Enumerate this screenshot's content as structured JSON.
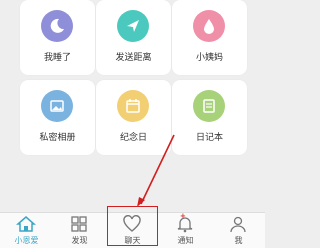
{
  "grid": {
    "row1": [
      {
        "label": "我睡了",
        "icon": "moon-icon",
        "color": "#8f8fd9"
      },
      {
        "label": "发送距离",
        "icon": "send-location-icon",
        "color": "#4cc9bf"
      },
      {
        "label": "小姨妈",
        "icon": "drop-icon",
        "color": "#f08fa8"
      }
    ],
    "row2": [
      {
        "label": "私密相册",
        "icon": "photo-icon",
        "color": "#7ab3df"
      },
      {
        "label": "纪念日",
        "icon": "calendar-icon",
        "color": "#f2cf72"
      },
      {
        "label": "日记本",
        "icon": "notebook-icon",
        "color": "#a8d27a"
      }
    ]
  },
  "tabbar": {
    "tabs": [
      {
        "label": "小恩爱",
        "icon": "home-icon",
        "active": true
      },
      {
        "label": "发现",
        "icon": "grid-icon",
        "active": false
      },
      {
        "label": "聊天",
        "icon": "heart-icon",
        "active": false
      },
      {
        "label": "通知",
        "icon": "bell-icon",
        "active": false
      },
      {
        "label": "我",
        "icon": "person-icon",
        "active": false
      }
    ],
    "badge": "+"
  },
  "annotation": {
    "color": "#d21e1e",
    "target": "聊天"
  }
}
